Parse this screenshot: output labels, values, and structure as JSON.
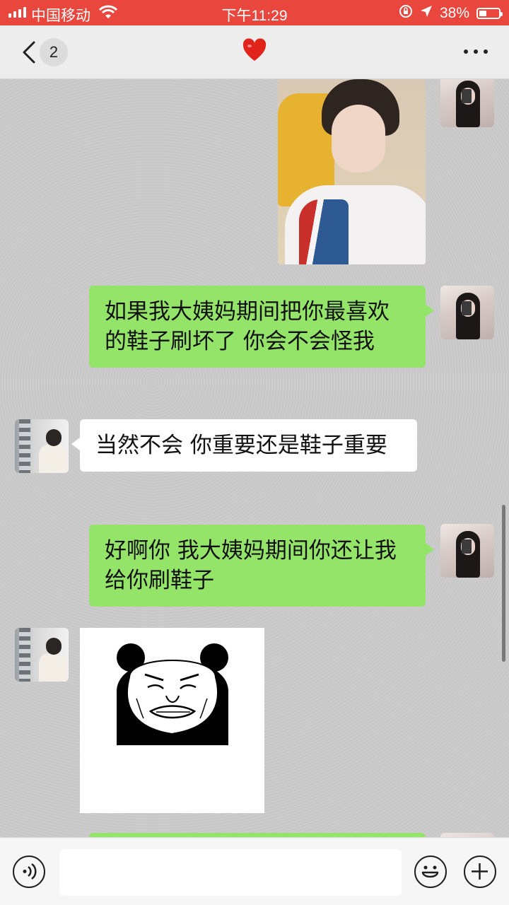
{
  "status_bar": {
    "carrier": "中国移动",
    "time": "下午11:29",
    "battery": "38%",
    "battery_level": 0.38
  },
  "nav": {
    "unread_count": "2",
    "title_icon": "heart-icon",
    "more_icon": "more-icon"
  },
  "messages": [
    {
      "from": "me",
      "type": "image",
      "content": "photo-of-boy"
    },
    {
      "from": "me",
      "type": "text",
      "text": "如果我大姨妈期间把你最喜欢的鞋子刷坏了 你会不会怪我"
    },
    {
      "from": "contact",
      "type": "text",
      "text": "当然不会 你重要还是鞋子重要"
    },
    {
      "from": "me",
      "type": "text",
      "text": "好啊你 我大姨妈期间你还让我给你刷鞋子"
    },
    {
      "from": "contact",
      "type": "sticker",
      "content": "panda-face-meme"
    }
  ],
  "input_bar": {
    "value": "",
    "voice_icon": "voice-icon",
    "emoji_icon": "emoji-icon",
    "plus_icon": "plus-icon"
  },
  "colors": {
    "status_bar": "#e9463d",
    "outgoing_bubble": "#95e46a",
    "incoming_bubble": "#ffffff",
    "chat_background": "#cbcbcb"
  }
}
